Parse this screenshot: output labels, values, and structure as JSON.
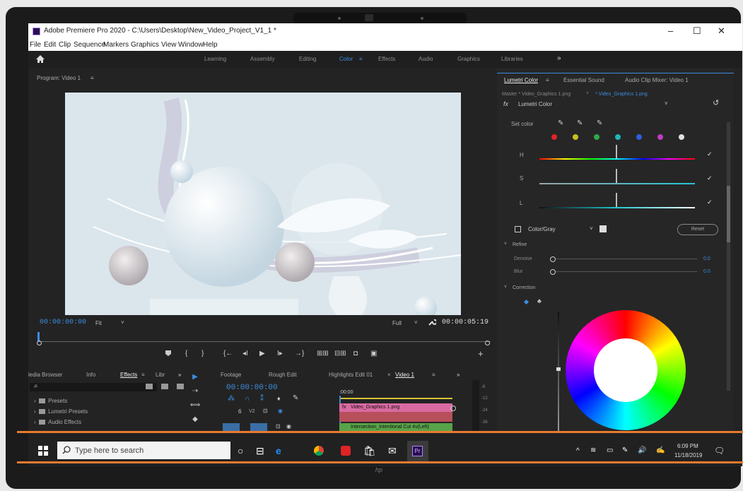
{
  "window": {
    "title": "Adobe Premiere Pro 2020 - C:\\Users\\Desktop\\New_Video_Project_V1_1 *",
    "controls": {
      "minimize": "–",
      "maximize": "☐",
      "close": "✕"
    }
  },
  "menu": [
    "File",
    "Edit",
    "Clip",
    "Sequence",
    "Markers",
    "Graphics",
    "View",
    "Window",
    "Help"
  ],
  "workspaces": {
    "items": [
      "Learning",
      "Assembly",
      "Editing",
      "Color",
      "Effects",
      "Audio",
      "Graphics",
      "Libraries"
    ],
    "active": "Color",
    "active_menu": "≡",
    "more": "»"
  },
  "program_monitor": {
    "label": "Program: Video 1",
    "label_menu": "≡",
    "timecode_current": "00:00:00:00",
    "fit": "Fit",
    "full": "Full",
    "timecode_end": "00:00:05:19",
    "add": "+"
  },
  "effects_panel": {
    "tabs": [
      "ledia Browser",
      "Info",
      "Effects",
      "Libr"
    ],
    "tab_menu": "≡",
    "more": "»",
    "search_icon": "⌕",
    "items": [
      "Presets",
      "Lumetri Presets",
      "Audio Effects"
    ]
  },
  "timeline": {
    "tabs": [
      "Footage",
      "Rough Edit",
      "Highlights Edit 01",
      "Video 1"
    ],
    "tab_close": "×",
    "tab_menu": "≡",
    "more": "»",
    "timecode": "00:00:00:00",
    "ruler_time": ":00:00",
    "track_label": "V2",
    "clip_pink": "Video_Graphics 1.png",
    "clip_green": "Intersection_Intentional Cut 4v(Left)",
    "meter_labels": [
      "-6",
      "-12",
      "-24",
      "-36"
    ]
  },
  "lumetri": {
    "tabs": [
      "Lumetri Color",
      "Essential Sound",
      "Audio Clip Mixer: Video 1"
    ],
    "tab_menu": "≡",
    "master_label": "Master * Video_Graphics 1.png",
    "clip_label": "* Video_Graphics 1.png",
    "fx_label": "fx",
    "fx_name": "Lumetri Color",
    "dropdown_arrow": "˅",
    "set_color": "Set color",
    "hsl": [
      "H",
      "S",
      "L"
    ],
    "check": "✓",
    "color_gray": "Color/Gray",
    "reset": "Reset",
    "refine": "Refine",
    "denoise": "Denoise",
    "denoise_value": "0.0",
    "blur": "Blur",
    "blur_value": "0.0",
    "correction": "Correction",
    "swatch_colors": [
      "#e02424",
      "#c8c020",
      "#2fa84a",
      "#21b6b6",
      "#2f5fe0",
      "#c03cc0",
      "#e0e0e0"
    ]
  },
  "taskbar": {
    "search_placeholder": "Type here to search",
    "time": "6:09 PM",
    "date": "11/18/2019",
    "app_label": "Pr"
  },
  "device": {
    "logo": "hp"
  }
}
